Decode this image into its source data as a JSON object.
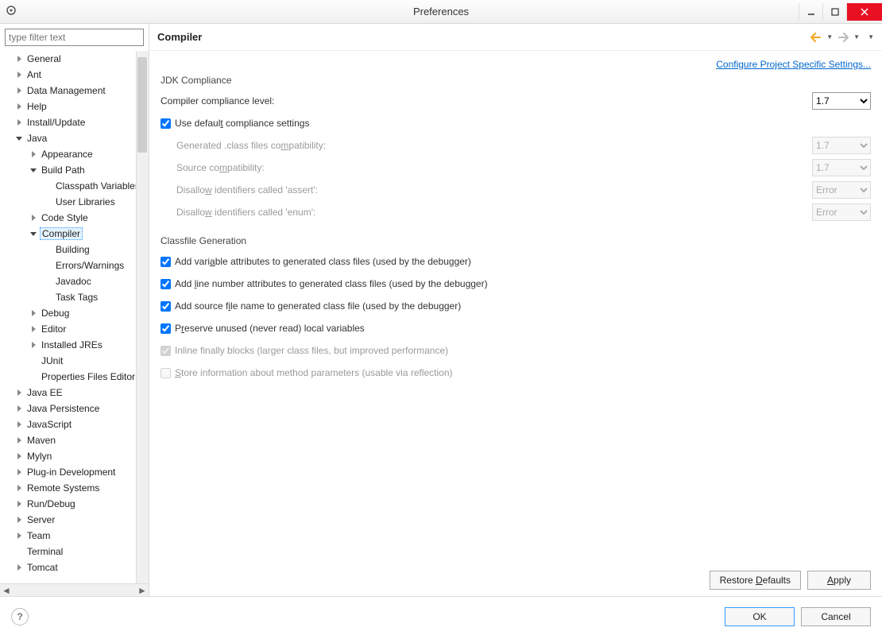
{
  "titlebar": {
    "title": "Preferences"
  },
  "filter": {
    "placeholder": "type filter text"
  },
  "tree": [
    {
      "lvl": 0,
      "arrow": "collapsed",
      "label": "General"
    },
    {
      "lvl": 0,
      "arrow": "collapsed",
      "label": "Ant"
    },
    {
      "lvl": 0,
      "arrow": "collapsed",
      "label": "Data Management"
    },
    {
      "lvl": 0,
      "arrow": "collapsed",
      "label": "Help"
    },
    {
      "lvl": 0,
      "arrow": "collapsed",
      "label": "Install/Update"
    },
    {
      "lvl": 0,
      "arrow": "expanded",
      "label": "Java"
    },
    {
      "lvl": 1,
      "arrow": "collapsed",
      "label": "Appearance"
    },
    {
      "lvl": 1,
      "arrow": "expanded",
      "label": "Build Path"
    },
    {
      "lvl": 2,
      "arrow": "none",
      "label": "Classpath Variables"
    },
    {
      "lvl": 2,
      "arrow": "none",
      "label": "User Libraries"
    },
    {
      "lvl": 1,
      "arrow": "collapsed",
      "label": "Code Style"
    },
    {
      "lvl": 1,
      "arrow": "expanded",
      "label": "Compiler",
      "selected": true
    },
    {
      "lvl": 2,
      "arrow": "none",
      "label": "Building"
    },
    {
      "lvl": 2,
      "arrow": "none",
      "label": "Errors/Warnings"
    },
    {
      "lvl": 2,
      "arrow": "none",
      "label": "Javadoc"
    },
    {
      "lvl": 2,
      "arrow": "none",
      "label": "Task Tags"
    },
    {
      "lvl": 1,
      "arrow": "collapsed",
      "label": "Debug"
    },
    {
      "lvl": 1,
      "arrow": "collapsed",
      "label": "Editor"
    },
    {
      "lvl": 1,
      "arrow": "collapsed",
      "label": "Installed JREs"
    },
    {
      "lvl": 1,
      "arrow": "none",
      "label": "JUnit"
    },
    {
      "lvl": 1,
      "arrow": "none",
      "label": "Properties Files Editor"
    },
    {
      "lvl": 0,
      "arrow": "collapsed",
      "label": "Java EE"
    },
    {
      "lvl": 0,
      "arrow": "collapsed",
      "label": "Java Persistence"
    },
    {
      "lvl": 0,
      "arrow": "collapsed",
      "label": "JavaScript"
    },
    {
      "lvl": 0,
      "arrow": "collapsed",
      "label": "Maven"
    },
    {
      "lvl": 0,
      "arrow": "collapsed",
      "label": "Mylyn"
    },
    {
      "lvl": 0,
      "arrow": "collapsed",
      "label": "Plug-in Development"
    },
    {
      "lvl": 0,
      "arrow": "collapsed",
      "label": "Remote Systems"
    },
    {
      "lvl": 0,
      "arrow": "collapsed",
      "label": "Run/Debug"
    },
    {
      "lvl": 0,
      "arrow": "collapsed",
      "label": "Server"
    },
    {
      "lvl": 0,
      "arrow": "collapsed",
      "label": "Team"
    },
    {
      "lvl": 0,
      "arrow": "none",
      "label": "Terminal"
    },
    {
      "lvl": 0,
      "arrow": "collapsed",
      "label": "Tomcat"
    }
  ],
  "page": {
    "heading": "Compiler",
    "config_link": "Configure Project Specific Settings...",
    "jdk": {
      "title": "JDK Compliance",
      "compliance_label": "Compiler compliance level:",
      "compliance_value": "1.7",
      "use_default_label": "Use default compliance settings",
      "gen_class_label": "Generated .class files compatibility:",
      "gen_class_value": "1.7",
      "source_compat_label": "Source compatibility:",
      "source_compat_value": "1.7",
      "disallow_assert_label": "Disallow identifiers called 'assert':",
      "disallow_assert_value": "Error",
      "disallow_enum_label": "Disallow identifiers called 'enum':",
      "disallow_enum_value": "Error"
    },
    "classfile": {
      "title": "Classfile Generation",
      "var_attr": "Add variable attributes to generated class files (used by the debugger)",
      "line_num": "Add line number attributes to generated class files (used by the debugger)",
      "src_file": "Add source file name to generated class file (used by the debugger)",
      "preserve": "Preserve unused (never read) local variables",
      "inline": "Inline finally blocks (larger class files, but improved performance)",
      "store": "Store information about method parameters (usable via reflection)"
    },
    "buttons": {
      "restore": "Restore Defaults",
      "apply": "Apply",
      "ok": "OK",
      "cancel": "Cancel"
    }
  }
}
